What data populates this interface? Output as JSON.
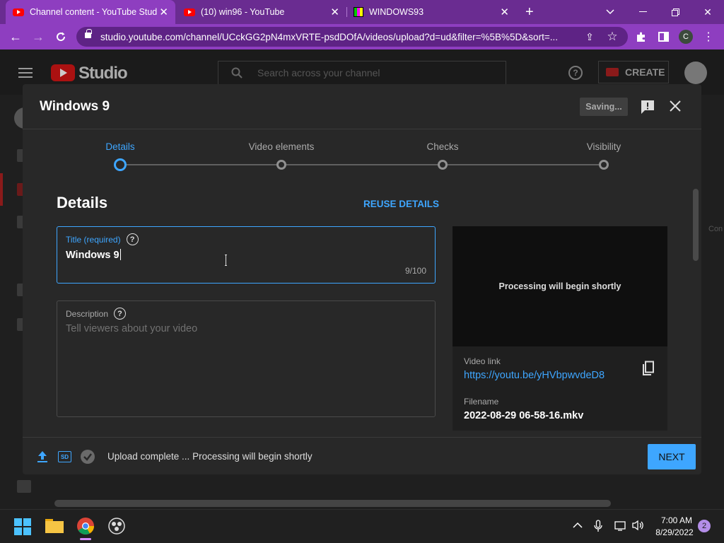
{
  "browser": {
    "tabs": [
      {
        "label": "Channel content - YouTube Studio",
        "icon": "youtube-icon"
      },
      {
        "label": "(10) win96 - YouTube",
        "icon": "youtube-icon"
      },
      {
        "label": "WINDOWS93",
        "icon": "windows93-icon"
      }
    ],
    "url": "studio.youtube.com/channel/UCckGG2pN4mxVRTE-psdDOfA/videos/upload?d=ud&filter=%5B%5D&sort=...",
    "profile_initial": "C"
  },
  "studio": {
    "logo_text": "Studio",
    "search_placeholder": "Search across your channel",
    "create_label": "CREATE",
    "behind_text": "Con"
  },
  "modal": {
    "title": "Windows 9",
    "saving_label": "Saving...",
    "steps": [
      {
        "label": "Details",
        "active": true
      },
      {
        "label": "Video elements",
        "active": false
      },
      {
        "label": "Checks",
        "active": false
      },
      {
        "label": "Visibility",
        "active": false
      }
    ],
    "section_title": "Details",
    "reuse_label": "REUSE DETAILS",
    "title_field": {
      "label": "Title (required)",
      "value": "Windows 9",
      "count": "9/100"
    },
    "description_field": {
      "label": "Description",
      "placeholder": "Tell viewers about your video"
    },
    "preview": {
      "player_text": "Processing will begin shortly",
      "video_link_label": "Video link",
      "video_link": "https://youtu.be/yHVbpwvdeD8",
      "filename_label": "Filename",
      "filename": "2022-08-29 06-58-16.mkv"
    },
    "footer": {
      "status": "Upload complete ... Processing will begin shortly",
      "hd_badge": "SD",
      "next_label": "NEXT"
    }
  },
  "taskbar": {
    "time": "7:00 AM",
    "date": "8/29/2022",
    "notification_count": "2"
  },
  "colors": {
    "accent": "#3ea6ff",
    "browser_frame": "#8e3ec0",
    "modal_bg": "#282828"
  }
}
